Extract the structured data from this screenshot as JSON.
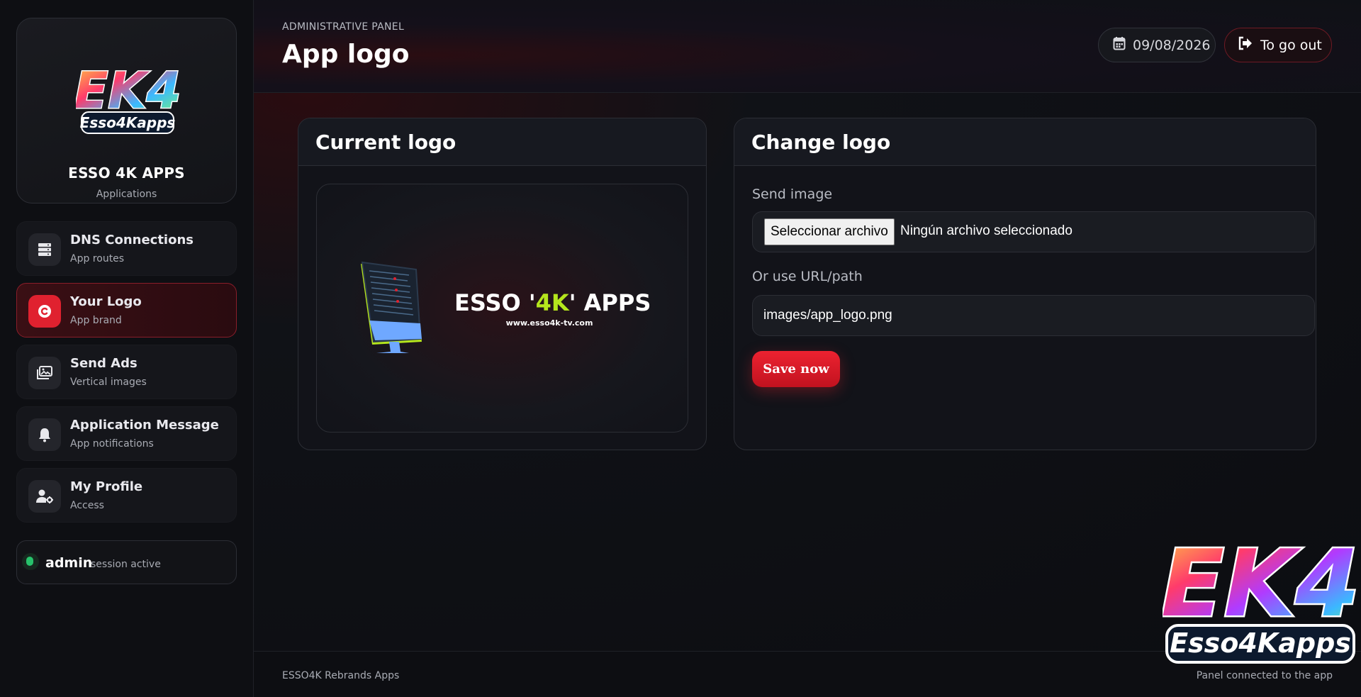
{
  "sidebar": {
    "brand": {
      "name": "ESSO 4K APPS",
      "subtitle": "Applications",
      "logo_text_main": "EK4",
      "logo_text_sub": "Esso4Kapps"
    },
    "nav": [
      {
        "title": "DNS Connections",
        "subtitle": "App routes",
        "icon": "server-icon",
        "active": false
      },
      {
        "title": "Your Logo",
        "subtitle": "App brand",
        "icon": "copyright-icon",
        "active": true
      },
      {
        "title": "Send Ads",
        "subtitle": "Vertical images",
        "icon": "images-icon",
        "active": false
      },
      {
        "title": "Application Message",
        "subtitle": "App notifications",
        "icon": "bell-icon",
        "active": false
      },
      {
        "title": "My Profile",
        "subtitle": "Access",
        "icon": "user-gear-icon",
        "active": false
      }
    ],
    "session": {
      "user": "admin",
      "status": "session active"
    }
  },
  "header": {
    "eyebrow": "ADMINISTRATIVE PANEL",
    "title": "App logo",
    "date": "09/08/2026",
    "logout_label": "To go out"
  },
  "current_logo_card": {
    "title": "Current logo",
    "preview": {
      "brand_text_left": "ESSO '",
      "brand_text_accent": "4K",
      "brand_text_right": "' APPS",
      "website": "www.esso4k-tv.com"
    }
  },
  "change_logo_card": {
    "title": "Change logo",
    "send_image_label": "Send image",
    "file_button_label": "Seleccionar archivo",
    "file_status": "Ningún archivo seleccionado",
    "url_label": "Or use URL/path",
    "url_value": "images/app_logo.png",
    "save_label": "Save now"
  },
  "footer": {
    "left": "ESSO4K Rebrands Apps",
    "right": "Panel connected to the app"
  },
  "colors": {
    "accent": "#e0212f",
    "lime": "#b5e61d",
    "background": "#0b0c10",
    "card": "#121319",
    "online": "#27c26b"
  }
}
